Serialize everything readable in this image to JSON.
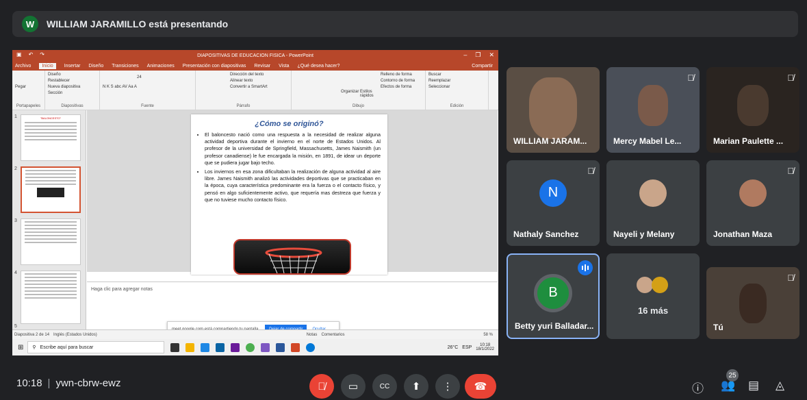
{
  "presenter": {
    "initial": "W",
    "text": "WILLIAM JARAMILLO está presentando"
  },
  "ppt": {
    "window_title": "DIAPOSITIVAS DE EDUCACION FISICA - PowerPoint",
    "tabs": [
      "Archivo",
      "Inicio",
      "Insertar",
      "Diseño",
      "Transiciones",
      "Animaciones",
      "Presentación con diapositivas",
      "Revisar",
      "Vista",
      "¿Qué desea hacer?"
    ],
    "share_label": "Compartir",
    "ribbon": {
      "clipboard": {
        "paste": "Pegar",
        "label": "Portapapeles"
      },
      "slides": {
        "new": "Nueva diapositiva",
        "layout": "Diseño",
        "reset": "Restablecer",
        "section": "Sección",
        "label": "Diapositivas"
      },
      "font": {
        "label": "Fuente",
        "size": "24"
      },
      "paragraph": {
        "dir": "Dirección del texto",
        "align": "Alinear texto",
        "smartart": "Convertir a SmartArt",
        "label": "Párrafo"
      },
      "drawing": {
        "organize": "Organizar",
        "styles": "Estilos rápidos",
        "fill": "Relleno de forma",
        "outline": "Contorno de forma",
        "effects": "Efectos de forma",
        "label": "Dibujo"
      },
      "editing": {
        "find": "Buscar",
        "replace": "Reemplazar",
        "select": "Seleccionar",
        "label": "Edición"
      }
    },
    "slide": {
      "title": "¿Cómo se originó?",
      "bullet1": "El baloncesto nació como una respuesta a la necesidad de realizar alguna actividad deportiva durante el invierno en el norte de Estados Unidos. Al profesor de la universidad de Springfield, Massachusetts, James Naismith (un profesor canadiense) le fue encargada la misión, en 1891, de idear un deporte que se pudiera jugar bajo techo.",
      "bullet2": "Los inviernos en esa zona dificultaban la realización de alguna actividad al aire libre. James Naismith analizó las actividades deportivas que se practicaban en la época, cuya característica predominante era la fuerza o el contacto físico, y pensó en algo suficientemente activo, que requería mas destreza que fuerza y que no tuviese mucho contacto físico."
    },
    "thumb_title": "\"BALONCESTO\"",
    "thumb_nums": [
      "1",
      "2",
      "3",
      "4",
      "5"
    ],
    "notes": "Haga clic para agregar notas",
    "status": {
      "slide": "Diapositiva 2 de 14",
      "lang": "Inglés (Estados Unidos)",
      "notes": "Notas",
      "comments": "Comentarios",
      "zoom": "58 %"
    },
    "popup": {
      "text": "meet.google.com está compartiendo tu pantalla.",
      "stop": "Dejar de compartir",
      "hide": "Ocultar"
    },
    "taskbar": {
      "search": "Escribe aquí para buscar",
      "temp": "26°C",
      "lang": "ESP",
      "time": "10:18",
      "date": "18/1/2022"
    }
  },
  "participants": [
    {
      "name": "WILLIAM JARAM..."
    },
    {
      "name": "Mercy Mabel Le..."
    },
    {
      "name": "Marian Paulette ..."
    },
    {
      "name": "Nathaly Sanchez",
      "initial": "N"
    },
    {
      "name": "Nayeli y Melany"
    },
    {
      "name": "Jonathan Maza"
    },
    {
      "name": "Betty yuri Balladar...",
      "initial": "B"
    },
    {
      "name": "16 más"
    },
    {
      "name": "Tú"
    }
  ],
  "bottom": {
    "time": "10:18",
    "code": "ywn-cbrw-ewz",
    "participants_count": "25"
  }
}
